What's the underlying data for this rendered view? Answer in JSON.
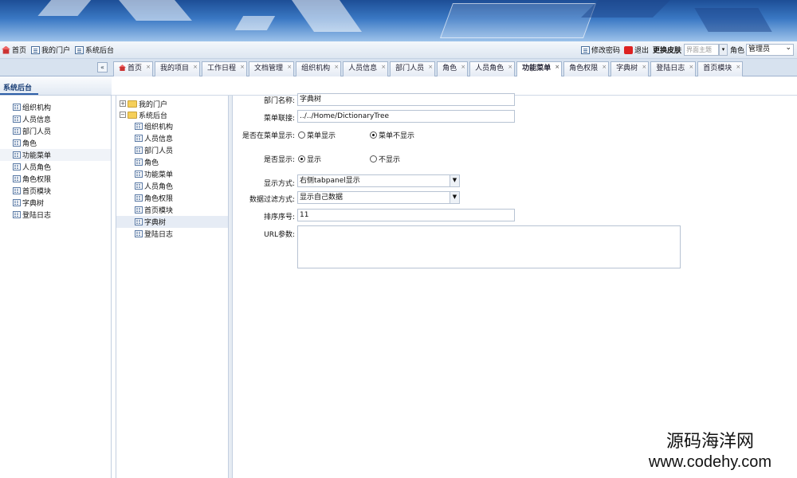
{
  "topbar": {
    "links": [
      "首页",
      "我的门户",
      "系统后台"
    ],
    "change_password": "修改密码",
    "logout": "退出",
    "change_skin": "更换皮肤",
    "skin_placeholder": "界面主题",
    "role_label": "角色",
    "role_value": "管理员"
  },
  "tabs": [
    {
      "label": "首页"
    },
    {
      "label": "我的项目"
    },
    {
      "label": "工作日程"
    },
    {
      "label": "文档管理"
    },
    {
      "label": "组织机构"
    },
    {
      "label": "人员信息"
    },
    {
      "label": "部门人员"
    },
    {
      "label": "角色"
    },
    {
      "label": "人员角色"
    },
    {
      "label": "功能菜单",
      "active": true
    },
    {
      "label": "角色权限"
    },
    {
      "label": "字典树"
    },
    {
      "label": "登陆日志"
    },
    {
      "label": "首页模块"
    }
  ],
  "collapse_glyph": "«",
  "sidebar": {
    "header": "系统后台",
    "items": [
      "组织机构",
      "人员信息",
      "部门人员",
      "角色",
      "功能菜单",
      "人员角色",
      "角色权限",
      "首页模块",
      "字典树",
      "登陆日志"
    ]
  },
  "tree": {
    "root1": "我的门户",
    "root2": "系统后台",
    "children": [
      "组织机构",
      "人员信息",
      "部门人员",
      "角色",
      "功能菜单",
      "人员角色",
      "角色权限",
      "首页模块",
      "字典树",
      "登陆日志"
    ],
    "selected": "字典树"
  },
  "form": {
    "name_label": "部门名称:",
    "name_value": "字典树",
    "link_label": "菜单联接:",
    "link_value": "../../Home/DictionaryTree",
    "show_in_menu_label": "是否在菜单显示:",
    "show_in_menu_options": [
      "菜单显示",
      "菜单不显示"
    ],
    "show_in_menu_selected": "菜单不显示",
    "visible_label": "是否显示:",
    "visible_options": [
      "显示",
      "不显示"
    ],
    "visible_selected": "显示",
    "display_mode_label": "显示方式:",
    "display_mode_value": "右侧tabpanel显示",
    "filter_label": "数据过滤方式:",
    "filter_value": "显示自己数据",
    "order_label": "排序序号:",
    "order_value": "11",
    "url_param_label": "URL参数:",
    "url_param_value": ""
  },
  "watermark": {
    "line1": "源码海洋网",
    "line2": "www.codehy.com"
  },
  "colors": {
    "banner_top": "#1d4e96",
    "banner_bottom": "#9ec3ea",
    "tabbar": "#d7e2ef",
    "header_text": "#1a3f77"
  }
}
